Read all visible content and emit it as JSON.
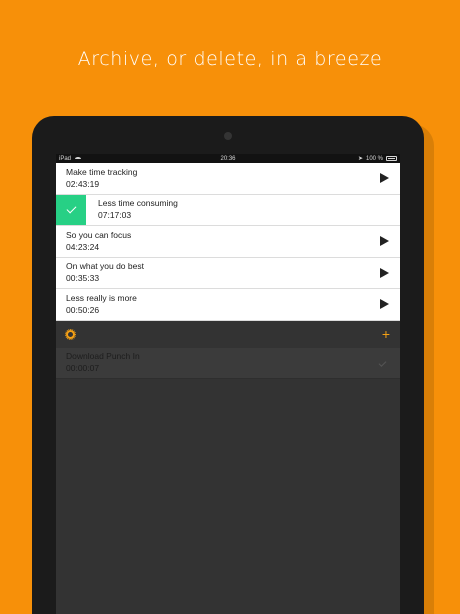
{
  "headline": "Archive, or delete, in a breeze",
  "statusbar": {
    "device": "iPad",
    "time": "20:36",
    "battery": "100 %"
  },
  "tasks": [
    {
      "name": "Make time tracking",
      "duration": "02:43:19",
      "swiped": false
    },
    {
      "name": "Less time consuming",
      "duration": "07:17:03",
      "swiped": true
    },
    {
      "name": "So you can focus",
      "duration": "04:23:24",
      "swiped": false
    },
    {
      "name": "On what you do best",
      "duration": "00:35:33",
      "swiped": false
    },
    {
      "name": "Less really is more",
      "duration": "00:50:26",
      "swiped": false
    }
  ],
  "toolbar": {
    "settings_icon": "gear-icon",
    "add_label": "+"
  },
  "archived": [
    {
      "name": "Download Punch In",
      "duration": "00:00:07"
    }
  ],
  "colors": {
    "background": "#F79009",
    "accent": "#F4A015",
    "swipe_green": "#27D085"
  }
}
